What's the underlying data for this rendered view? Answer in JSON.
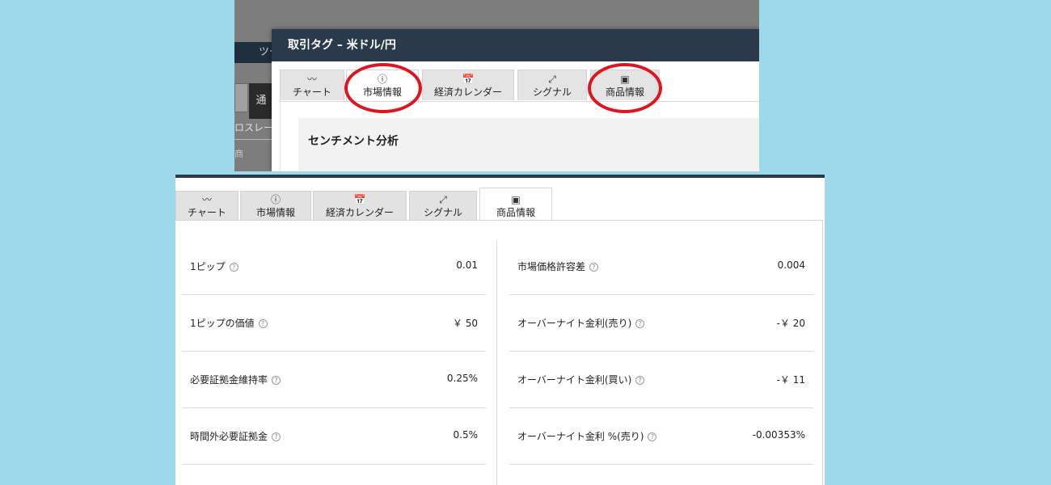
{
  "background_app": {
    "nav_label": "ツー",
    "button_label": "通",
    "row_label": "ロスレー",
    "partial_char": "商"
  },
  "dialog": {
    "title": "取引タグ – 米ドル/円",
    "section_title": "センチメント分析"
  },
  "tabs": [
    {
      "label": "チャート",
      "icon": "line-chart-icon",
      "glyph": "〰"
    },
    {
      "label": "市場情報",
      "icon": "info-icon",
      "glyph": "ⓘ"
    },
    {
      "label": "経済カレンダー",
      "icon": "calendar-icon",
      "glyph": "📅"
    },
    {
      "label": "シグナル",
      "icon": "signal-icon",
      "glyph": "⤢"
    },
    {
      "label": "商品情報",
      "icon": "presentation-icon",
      "glyph": "▣"
    }
  ],
  "highlight_color": "#e0141e",
  "header_color": "#2a3a4a",
  "product_info": {
    "left": [
      {
        "label": "1ピップ",
        "value": "0.01"
      },
      {
        "label": "1ピップの価値",
        "value": "￥ 50"
      },
      {
        "label": "必要証拠金維持率",
        "value": "0.25%"
      },
      {
        "label": "時間外必要証拠金",
        "value": "0.5%"
      }
    ],
    "right": [
      {
        "label": "市場価格許容差",
        "value": "0.004"
      },
      {
        "label": "オーバーナイト金利(売り)",
        "value": "-￥ 20"
      },
      {
        "label": "オーバーナイト金利(買い)",
        "value": "-￥ 11"
      },
      {
        "label": "オーバーナイト金利 %(売り)",
        "value": "-0.00353%"
      }
    ],
    "help_glyph": "?"
  }
}
